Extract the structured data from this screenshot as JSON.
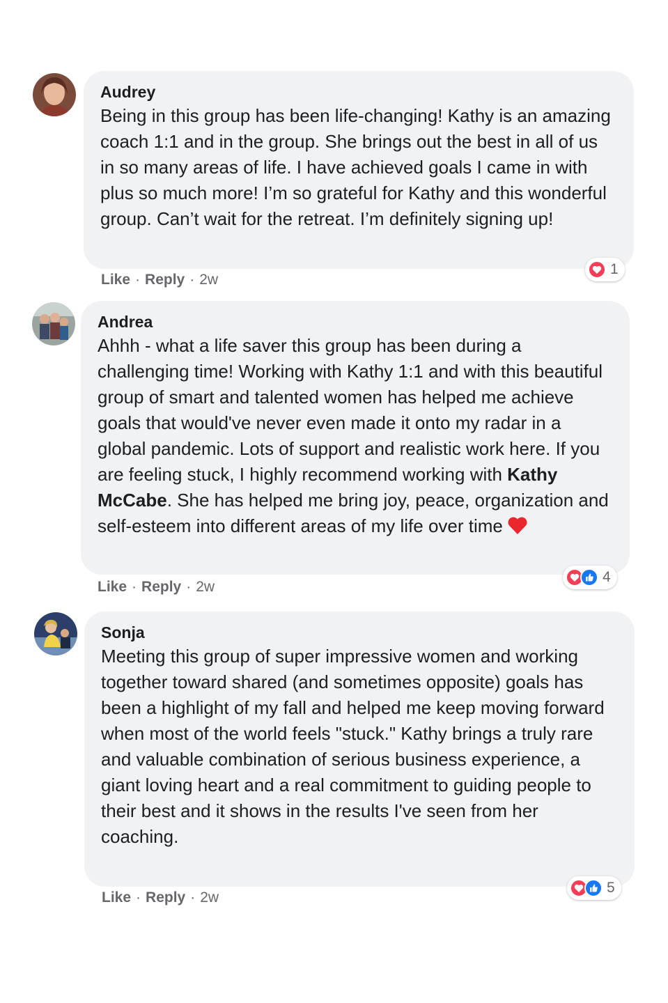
{
  "comments": [
    {
      "author": "Audrey",
      "text": "Being in this group has been life-changing! Kathy is an amazing coach 1:1 and in the group. She brings out the best in all of us in so many areas of life. I have achieved goals I came in with plus so much more! I’m so grateful for Kathy and this wonderful group. Can’t wait for the retreat. I’m definitely signing up!",
      "like_label": "Like",
      "reply_label": "Reply",
      "time": "2w",
      "reaction_count": "1",
      "reactions": [
        "love-icon"
      ]
    },
    {
      "author": "Andrea",
      "text_before": "Ahhh - what a life saver this group has been during a challenging time! Working with Kathy 1:1 and with this beautiful group of smart and talented women has helped me achieve goals that would've never even made it onto my radar in a global pandemic. Lots of support and realistic work here. If you are feeling stuck, I highly recommend working with ",
      "mention": "Kathy McCabe",
      "text_after": ". She has helped me bring joy, peace, organization and self-esteem into different areas of my life over time",
      "like_label": "Like",
      "reply_label": "Reply",
      "time": "2w",
      "reaction_count": "4",
      "reactions": [
        "love-icon",
        "like-icon"
      ]
    },
    {
      "author": "Sonja",
      "text": "Meeting this group of super impressive women and working together toward shared (and sometimes opposite) goals has been a highlight of my fall and helped me keep moving forward when most of the world feels \"stuck.\" Kathy brings a truly rare and valuable combination of serious business experience, a giant loving heart and a real commitment to guiding people to their best and it shows in the results I've seen from her coaching.",
      "like_label": "Like",
      "reply_label": "Reply",
      "time": "2w",
      "reaction_count": "5",
      "reactions": [
        "love-icon",
        "like-icon"
      ]
    }
  ],
  "separator": "·",
  "colors": {
    "bubble_bg": "#f0f2f5",
    "meta_text": "#65676b",
    "love": "#f33e58",
    "like": "#1877f2"
  }
}
